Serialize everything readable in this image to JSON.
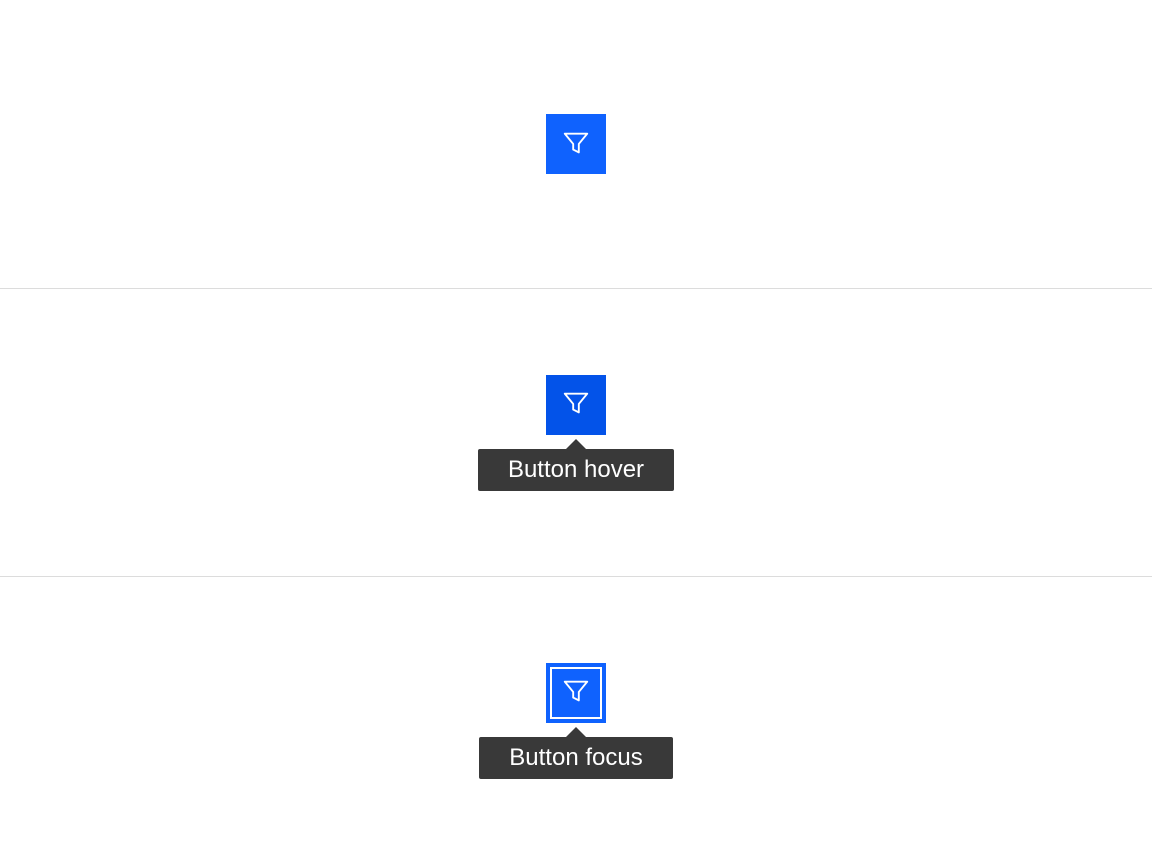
{
  "states": {
    "default": {
      "icon": "filter-icon"
    },
    "hover": {
      "icon": "filter-icon",
      "tooltip": "Button hover"
    },
    "focus": {
      "icon": "filter-icon",
      "tooltip": "Button focus"
    }
  },
  "colors": {
    "primary": "#0f62fe",
    "primary_hover": "#0353e9",
    "tooltip_bg": "#393939",
    "tooltip_text": "#ffffff",
    "divider": "#dcdcdc"
  }
}
